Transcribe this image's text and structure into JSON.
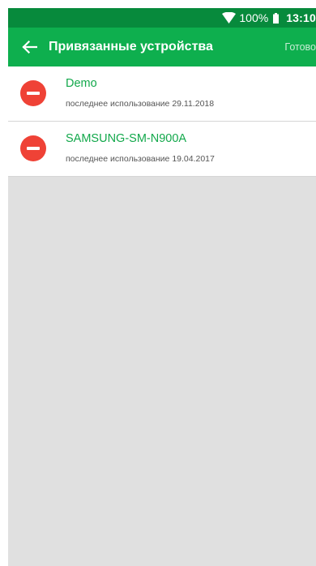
{
  "status_bar": {
    "battery_percent": "100%",
    "time": "13:10",
    "icons": [
      "wifi-icon",
      "battery-icon"
    ]
  },
  "app_bar": {
    "title": "Привязанные устройства",
    "action_label": "Готово",
    "back_icon": "arrow-left-icon"
  },
  "colors": {
    "status_bar": "#078a3c",
    "app_bar": "#0eaf4e",
    "accent_text": "#12a84b",
    "remove_button": "#ef4236",
    "background": "#e0e0e0"
  },
  "devices": [
    {
      "name": "Demo",
      "last_used_label": "последнее использование",
      "last_used_date": "29.11.2018"
    },
    {
      "name": "SAMSUNG-SM-N900A",
      "last_used_label": "последнее использование",
      "last_used_date": "19.04.2017"
    }
  ]
}
